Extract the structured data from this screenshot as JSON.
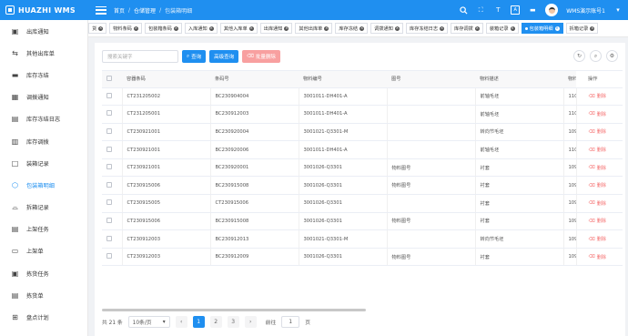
{
  "app": {
    "title": "HUAZHI WMS"
  },
  "breadcrumb": {
    "home": "首页",
    "sep": "/",
    "section": "仓储管理",
    "current": "包装箱明细"
  },
  "user": {
    "name": "WMS演示账号1"
  },
  "topIcons": {
    "fullscreen": "⛶",
    "font": "T",
    "lang": "A",
    "chat": "▬"
  },
  "sidebar": {
    "items": [
      {
        "label": "出库通知",
        "icon": "▣"
      },
      {
        "label": "其他出库单",
        "icon": "⇆"
      },
      {
        "label": "库存冻结",
        "icon": "▬"
      },
      {
        "label": "调拨通知",
        "icon": "▦"
      },
      {
        "label": "库存冻结日志",
        "icon": "▤"
      },
      {
        "label": "库存调拨",
        "icon": "▥"
      },
      {
        "label": "装箱记录",
        "icon": "□"
      },
      {
        "label": "包装箱明细",
        "icon": "⬡"
      },
      {
        "label": "拆箱记录",
        "icon": "⌓"
      },
      {
        "label": "上架任务",
        "icon": "▤"
      },
      {
        "label": "上架单",
        "icon": "▭"
      },
      {
        "label": "拣货任务",
        "icon": "▣"
      },
      {
        "label": "拣货单",
        "icon": "▤"
      },
      {
        "label": "盘点计划",
        "icon": "⊞"
      }
    ]
  },
  "tabs": [
    {
      "label": "货"
    },
    {
      "label": "物料条码"
    },
    {
      "label": "包装箱条码"
    },
    {
      "label": "入库通知"
    },
    {
      "label": "其他入库单"
    },
    {
      "label": "出库通知"
    },
    {
      "label": "其他出库单"
    },
    {
      "label": "库存冻结"
    },
    {
      "label": "调拨通知"
    },
    {
      "label": "库存冻结日志"
    },
    {
      "label": "库存调拨"
    },
    {
      "label": "装箱记录"
    },
    {
      "label": "包装箱明细",
      "active": true
    },
    {
      "label": "拆箱记录"
    }
  ],
  "toolbar": {
    "search_placeholder": "搜索关键字",
    "search_label": "查询",
    "advanced_label": "高级查询",
    "batch_delete_label": "批量删除"
  },
  "table": {
    "headers": [
      "容器条码",
      "条码号",
      "物料编号",
      "图号",
      "物料描述",
      "物料",
      "操作"
    ],
    "delete_label": "删除",
    "rows": [
      [
        "CT231205002",
        "BC230904004",
        "3001011-DH401-A",
        "",
        "前轴毛坯",
        "110"
      ],
      [
        "CT231205001",
        "BC230912003",
        "3001011-DH401-A",
        "",
        "前轴毛坯",
        "110"
      ],
      [
        "CT230921001",
        "BC230920004",
        "3001021-Q3301-M",
        "",
        "转向节毛坯",
        "109"
      ],
      [
        "CT230921001",
        "BC230920006",
        "3001011-DH401-A",
        "",
        "前轴毛坯",
        "110"
      ],
      [
        "CT230921001",
        "BC230920001",
        "3001026-Q3301",
        "物料图号",
        "衬套",
        "109"
      ],
      [
        "CT230915006",
        "BC230915008",
        "3001026-Q3301",
        "物料图号",
        "衬套",
        "109"
      ],
      [
        "CT230915005",
        "CT230915006",
        "3001026-Q3301",
        "",
        "衬套",
        "109"
      ],
      [
        "CT230915006",
        "BC230915008",
        "3001026-Q3301",
        "物料图号",
        "衬套",
        "109"
      ],
      [
        "CT230912003",
        "BC230912013",
        "3001021-Q3301-M",
        "",
        "转向节毛坯",
        "109"
      ],
      [
        "CT230912003",
        "BC230912009",
        "3001026-Q3301",
        "物料图号",
        "衬套",
        "109"
      ]
    ]
  },
  "pagination": {
    "total_text": "共 21 条",
    "page_size": "10条/页",
    "pages": [
      "1",
      "2",
      "3"
    ],
    "current": "1",
    "goto_label": "前往",
    "goto_value": "1",
    "page_suffix": "页"
  }
}
